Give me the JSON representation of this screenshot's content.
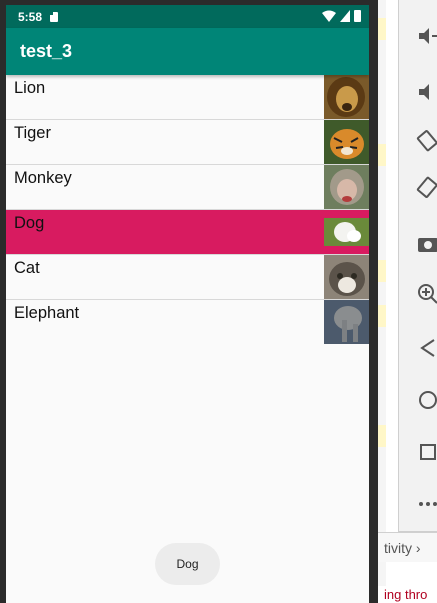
{
  "status": {
    "time": "5:58"
  },
  "app": {
    "title": "test_3"
  },
  "list": {
    "items": [
      {
        "label": "Lion"
      },
      {
        "label": "Tiger"
      },
      {
        "label": "Monkey"
      },
      {
        "label": "Dog",
        "selected": true
      },
      {
        "label": "Cat"
      },
      {
        "label": "Elephant"
      }
    ]
  },
  "toast": {
    "text": "Dog"
  },
  "ide": {
    "tab_label": "tivity",
    "log_text": "ing thro"
  },
  "colors": {
    "statusbar": "#016a5c",
    "toolbar": "#008577",
    "selected_row": "#d81b60"
  },
  "icons": {
    "emulator": [
      "volume-down-icon",
      "volume-up-icon",
      "rotate-left-icon",
      "rotate-right-icon",
      "camera-icon",
      "zoom-in-icon",
      "back-icon",
      "home-icon",
      "overview-icon",
      "more-icon"
    ]
  }
}
